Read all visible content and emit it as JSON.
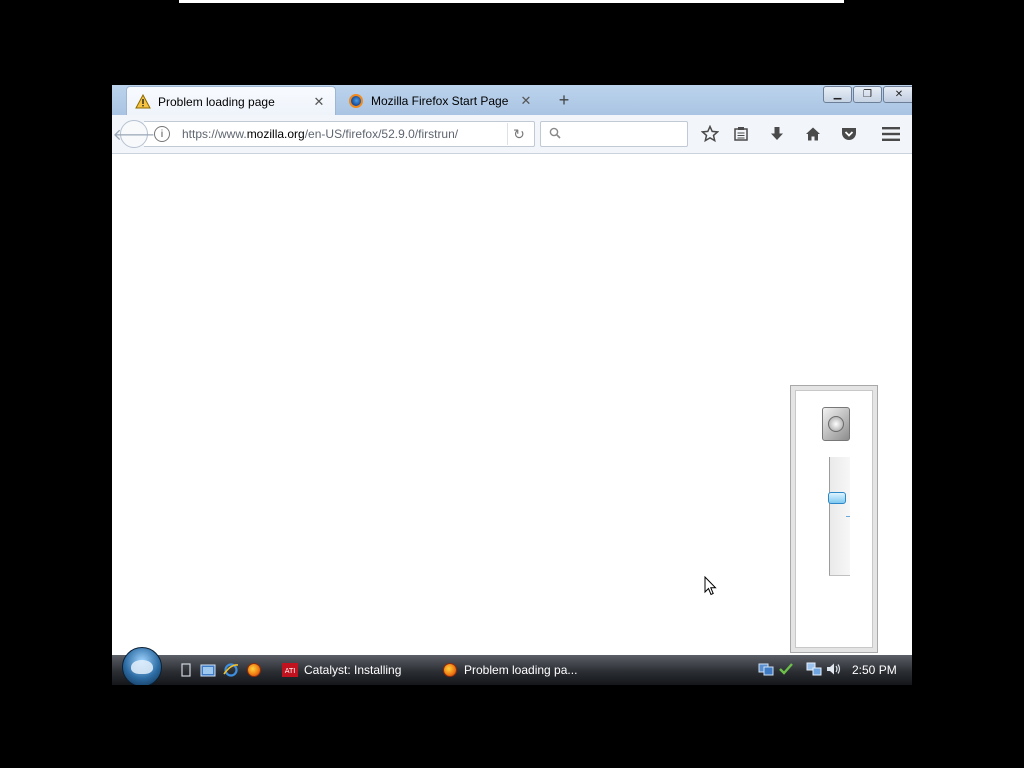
{
  "browser": {
    "tabs": [
      {
        "label": "Problem loading page",
        "active": true,
        "icon": "warning-icon"
      },
      {
        "label": "Mozilla Firefox Start Page",
        "active": false,
        "icon": "firefox-icon"
      }
    ],
    "new_tab_symbol": "+",
    "window_buttons": {
      "minimize": "▁",
      "restore": "❐",
      "close": "✕"
    },
    "url": {
      "prefix": "https://www.",
      "domain": "mozilla.org",
      "path": "/en-US/firefox/52.9.0/firstrun/"
    },
    "search_placeholder": "",
    "toolbar_icons": [
      "star-icon",
      "reading-list-icon",
      "download-icon",
      "home-icon",
      "pocket-icon",
      "menu-icon"
    ]
  },
  "volume_mixer": {
    "icon": "speaker-icon",
    "level_percent": 68
  },
  "taskbar": {
    "quicklaunch": [
      "show-desktop-icon",
      "switch-windows-icon",
      "internet-explorer-icon",
      "firefox-icon"
    ],
    "buttons": [
      {
        "label": "Catalyst: Installing",
        "icon": "ati-icon"
      },
      {
        "label": "Problem loading pa...",
        "icon": "firefox-icon"
      }
    ],
    "tray_icons": [
      "network-status-icon",
      "security-check-icon",
      "network-icon",
      "volume-icon"
    ],
    "clock": "2:50 PM"
  },
  "colors": {
    "tab_strip": "#bcd3ec",
    "taskbar": "#2b2e33",
    "background": "#000000"
  }
}
